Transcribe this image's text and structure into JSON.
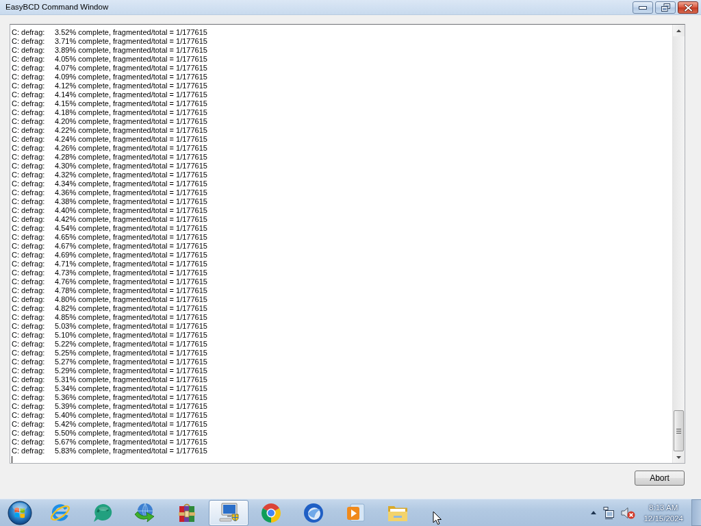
{
  "window": {
    "title": "EasyBCD Command Window"
  },
  "log": {
    "lines": [
      {
        "source": "C: defrag:",
        "message": "3.52% complete, fragmented/total = 1/177615"
      },
      {
        "source": "C: defrag:",
        "message": "3.71% complete, fragmented/total = 1/177615"
      },
      {
        "source": "C: defrag:",
        "message": "3.89% complete, fragmented/total = 1/177615"
      },
      {
        "source": "C: defrag:",
        "message": "4.05% complete, fragmented/total = 1/177615"
      },
      {
        "source": "C: defrag:",
        "message": "4.07% complete, fragmented/total = 1/177615"
      },
      {
        "source": "C: defrag:",
        "message": "4.09% complete, fragmented/total = 1/177615"
      },
      {
        "source": "C: defrag:",
        "message": "4.12% complete, fragmented/total = 1/177615"
      },
      {
        "source": "C: defrag:",
        "message": "4.14% complete, fragmented/total = 1/177615"
      },
      {
        "source": "C: defrag:",
        "message": "4.15% complete, fragmented/total = 1/177615"
      },
      {
        "source": "C: defrag:",
        "message": "4.18% complete, fragmented/total = 1/177615"
      },
      {
        "source": "C: defrag:",
        "message": "4.20% complete, fragmented/total = 1/177615"
      },
      {
        "source": "C: defrag:",
        "message": "4.22% complete, fragmented/total = 1/177615"
      },
      {
        "source": "C: defrag:",
        "message": "4.24% complete, fragmented/total = 1/177615"
      },
      {
        "source": "C: defrag:",
        "message": "4.26% complete, fragmented/total = 1/177615"
      },
      {
        "source": "C: defrag:",
        "message": "4.28% complete, fragmented/total = 1/177615"
      },
      {
        "source": "C: defrag:",
        "message": "4.30% complete, fragmented/total = 1/177615"
      },
      {
        "source": "C: defrag:",
        "message": "4.32% complete, fragmented/total = 1/177615"
      },
      {
        "source": "C: defrag:",
        "message": "4.34% complete, fragmented/total = 1/177615"
      },
      {
        "source": "C: defrag:",
        "message": "4.36% complete, fragmented/total = 1/177615"
      },
      {
        "source": "C: defrag:",
        "message": "4.38% complete, fragmented/total = 1/177615"
      },
      {
        "source": "C: defrag:",
        "message": "4.40% complete, fragmented/total = 1/177615"
      },
      {
        "source": "C: defrag:",
        "message": "4.42% complete, fragmented/total = 1/177615"
      },
      {
        "source": "C: defrag:",
        "message": "4.54% complete, fragmented/total = 1/177615"
      },
      {
        "source": "C: defrag:",
        "message": "4.65% complete, fragmented/total = 1/177615"
      },
      {
        "source": "C: defrag:",
        "message": "4.67% complete, fragmented/total = 1/177615"
      },
      {
        "source": "C: defrag:",
        "message": "4.69% complete, fragmented/total = 1/177615"
      },
      {
        "source": "C: defrag:",
        "message": "4.71% complete, fragmented/total = 1/177615"
      },
      {
        "source": "C: defrag:",
        "message": "4.73% complete, fragmented/total = 1/177615"
      },
      {
        "source": "C: defrag:",
        "message": "4.76% complete, fragmented/total = 1/177615"
      },
      {
        "source": "C: defrag:",
        "message": "4.78% complete, fragmented/total = 1/177615"
      },
      {
        "source": "C: defrag:",
        "message": "4.80% complete, fragmented/total = 1/177615"
      },
      {
        "source": "C: defrag:",
        "message": "4.82% complete, fragmented/total = 1/177615"
      },
      {
        "source": "C: defrag:",
        "message": "4.85% complete, fragmented/total = 1/177615"
      },
      {
        "source": "C: defrag:",
        "message": "5.03% complete, fragmented/total = 1/177615"
      },
      {
        "source": "C: defrag:",
        "message": "5.10% complete, fragmented/total = 1/177615"
      },
      {
        "source": "C: defrag:",
        "message": "5.22% complete, fragmented/total = 1/177615"
      },
      {
        "source": "C: defrag:",
        "message": "5.25% complete, fragmented/total = 1/177615"
      },
      {
        "source": "C: defrag:",
        "message": "5.27% complete, fragmented/total = 1/177615"
      },
      {
        "source": "C: defrag:",
        "message": "5.29% complete, fragmented/total = 1/177615"
      },
      {
        "source": "C: defrag:",
        "message": "5.31% complete, fragmented/total = 1/177615"
      },
      {
        "source": "C: defrag:",
        "message": "5.34% complete, fragmented/total = 1/177615"
      },
      {
        "source": "C: defrag:",
        "message": "5.36% complete, fragmented/total = 1/177615"
      },
      {
        "source": "C: defrag:",
        "message": "5.39% complete, fragmented/total = 1/177615"
      },
      {
        "source": "C: defrag:",
        "message": "5.40% complete, fragmented/total = 1/177615"
      },
      {
        "source": "C: defrag:",
        "message": "5.42% complete, fragmented/total = 1/177615"
      },
      {
        "source": "C: defrag:",
        "message": "5.50% complete, fragmented/total = 1/177615"
      },
      {
        "source": "C: defrag:",
        "message": "5.67% complete, fragmented/total = 1/177615"
      },
      {
        "source": "C: defrag:",
        "message": "5.83% complete, fragmented/total = 1/177615"
      }
    ]
  },
  "buttons": [
    {
      "label": "Abort"
    }
  ],
  "taskbar": {
    "apps": [
      {
        "kind": "browser",
        "selected": false
      },
      {
        "kind": "chat",
        "selected": false
      },
      {
        "kind": "download",
        "selected": false
      },
      {
        "kind": "archive",
        "selected": false
      },
      {
        "kind": "computer",
        "selected": true
      },
      {
        "kind": "wheel",
        "selected": false
      },
      {
        "kind": "mail",
        "selected": false
      },
      {
        "kind": "player",
        "selected": false
      },
      {
        "kind": "folder",
        "selected": false
      }
    ]
  },
  "tray": {
    "volume": {
      "muted": true
    },
    "clock": {
      "time": "8:13 AM",
      "date": "12/15/2024"
    }
  }
}
